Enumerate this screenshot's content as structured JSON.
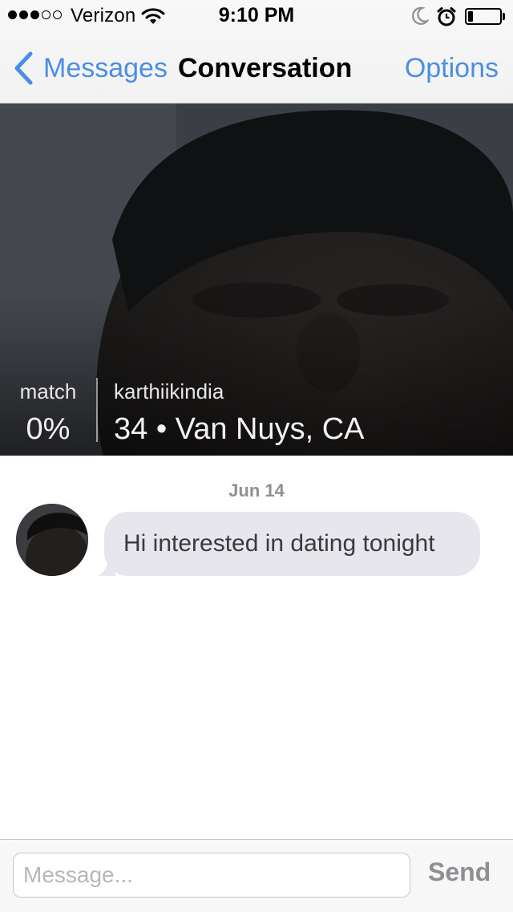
{
  "status_bar": {
    "signal_bars_filled": 3,
    "signal_bars_total": 5,
    "carrier": "Verizon",
    "time": "9:10 PM",
    "icons": [
      "wifi-icon",
      "moon-icon",
      "alarm-icon",
      "battery-icon"
    ],
    "battery_level": 0.15
  },
  "nav": {
    "back_label": "Messages",
    "title": "Conversation",
    "options_label": "Options",
    "accent_color": "#4a8ee5"
  },
  "profile": {
    "match_label": "match",
    "match_value": "0%",
    "username": "karthiikindia",
    "details": "34 • Van Nuys, CA"
  },
  "conversation": {
    "date": "Jun 14",
    "messages": [
      {
        "text": "Hi interested in dating tonight",
        "direction": "incoming"
      }
    ]
  },
  "composer": {
    "placeholder": "Message...",
    "value": "",
    "send_label": "Send"
  }
}
